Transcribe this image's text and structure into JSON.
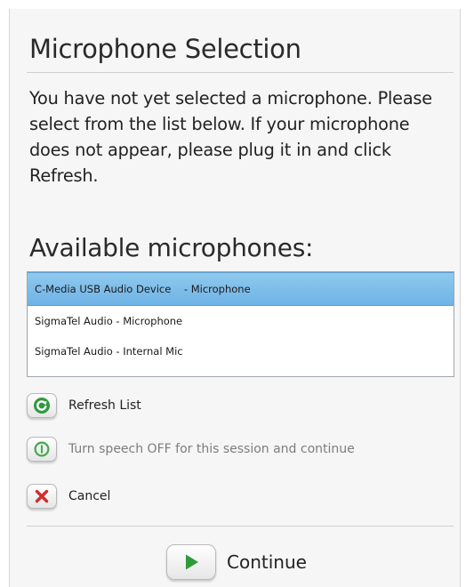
{
  "dialog": {
    "title": "Microphone Selection",
    "intro": "You have not yet selected a microphone. Please select from the list below.  If your microphone does not appear, please plug it in and click Refresh.",
    "available_heading": "Available microphones:"
  },
  "microphones": [
    {
      "label": "C-Media USB Audio Device    - Microphone",
      "selected": true
    },
    {
      "label": "SigmaTel Audio - Microphone",
      "selected": false
    },
    {
      "label": "SigmaTel Audio - Internal Mic",
      "selected": false
    }
  ],
  "actions": {
    "refresh": {
      "label": "Refresh List",
      "icon": "refresh-icon",
      "color": "#2f9a3c"
    },
    "speech_off": {
      "label": "Turn speech OFF for this session and continue",
      "icon": "power-icon",
      "color": "#3fa04b"
    },
    "cancel": {
      "label": "Cancel",
      "icon": "close-icon",
      "color": "#d22b2b"
    }
  },
  "continue": {
    "label": "Continue",
    "icon": "play-icon",
    "color": "#2e9b3a"
  },
  "colors": {
    "selection": "#7bbbe9",
    "background": "#f6f6f6"
  }
}
